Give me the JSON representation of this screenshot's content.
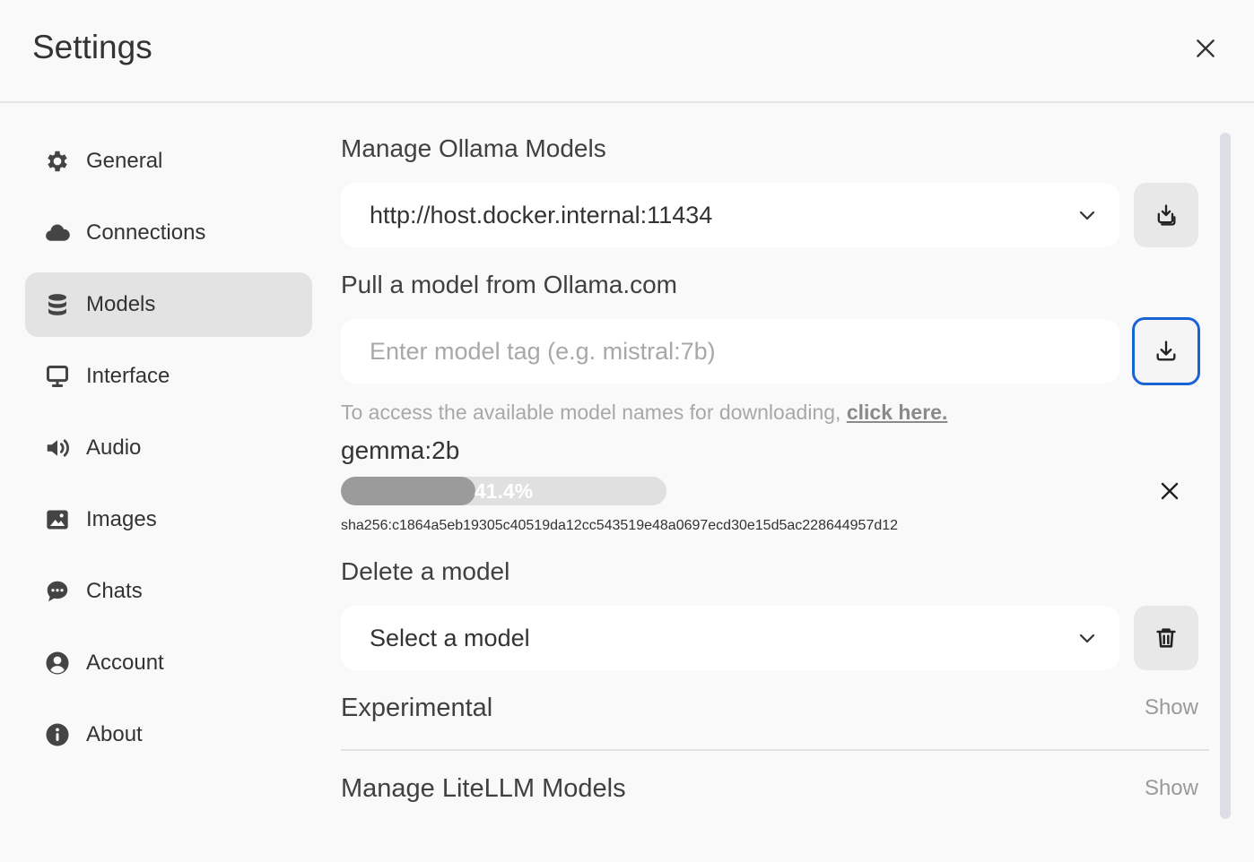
{
  "header": {
    "title": "Settings"
  },
  "sidebar": {
    "items": [
      {
        "label": "General",
        "icon": "gear-icon"
      },
      {
        "label": "Connections",
        "icon": "cloud-icon"
      },
      {
        "label": "Models",
        "icon": "database-icon",
        "active": true
      },
      {
        "label": "Interface",
        "icon": "monitor-icon"
      },
      {
        "label": "Audio",
        "icon": "speaker-icon"
      },
      {
        "label": "Images",
        "icon": "image-icon"
      },
      {
        "label": "Chats",
        "icon": "chat-bubble-icon"
      },
      {
        "label": "Account",
        "icon": "user-circle-icon"
      },
      {
        "label": "About",
        "icon": "info-icon"
      }
    ]
  },
  "main": {
    "manage_ollama": {
      "heading": "Manage Ollama Models",
      "url_value": "http://host.docker.internal:11434"
    },
    "pull": {
      "heading": "Pull a model from Ollama.com",
      "placeholder": "Enter model tag (e.g. mistral:7b)",
      "hint_text": "To access the available model names for downloading, ",
      "hint_link": "click here."
    },
    "download": {
      "model_name": "gemma:2b",
      "progress": 0.414,
      "progress_label": "41.4%",
      "digest": "sha256:c1864a5eb19305c40519da12cc543519e48a0697ecd30e15d5ac228644957d12"
    },
    "delete": {
      "heading": "Delete a model",
      "select_value": "Select a model"
    },
    "experimental": {
      "label": "Experimental",
      "toggle": "Show"
    },
    "litellm": {
      "label": "Manage LiteLLM Models",
      "toggle": "Show"
    }
  },
  "colors": {
    "accent_focus": "#1a63d6",
    "progress_fill": "#9b9b9b",
    "active_nav": "#e3e3e3"
  }
}
